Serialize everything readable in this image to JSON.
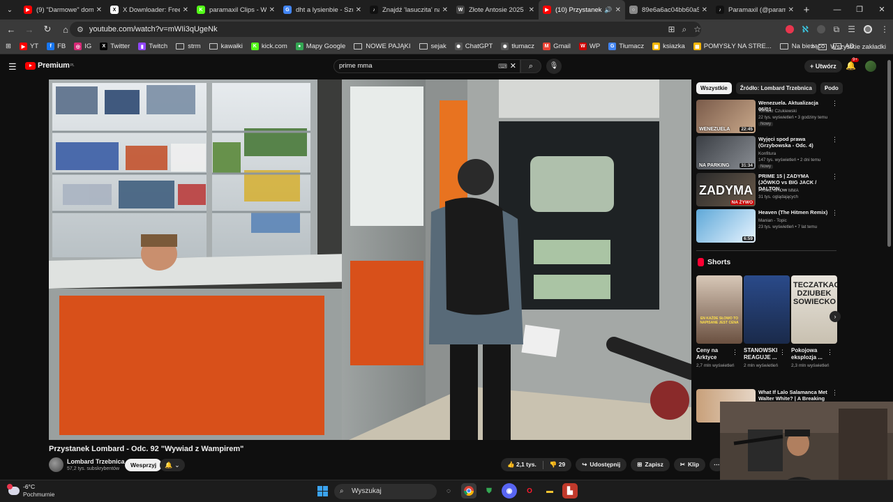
{
  "browser": {
    "tabs": [
      {
        "title": "(9) \"Darmowe\" domy",
        "favicon_color": "#ff0000",
        "favicon": "▶"
      },
      {
        "title": "X Downloader: Free T",
        "favicon_color": "#ffffff",
        "favicon": "X"
      },
      {
        "title": "paramaxil Clips - Wat",
        "favicon_color": "#53fc18",
        "favicon": "K"
      },
      {
        "title": "dht a lysienbie - Szuk",
        "favicon_color": "#4285f4",
        "favicon": "G"
      },
      {
        "title": "Znajdź 'lasuczita' na",
        "favicon_color": "#111111",
        "favicon": "♪"
      },
      {
        "title": "Złote Antosie 2025 -",
        "favicon_color": "#444444",
        "favicon": "W"
      },
      {
        "title": "(10) Przystanek Lo",
        "favicon_color": "#ff0000",
        "favicon": "▶",
        "active": true
      },
      {
        "title": "89e6a6ac04bb60a51",
        "favicon_color": "#888888",
        "favicon": "○"
      },
      {
        "title": "Paramaxil (@param",
        "favicon_color": "#111111",
        "favicon": "♪"
      }
    ],
    "url": "youtube.com/watch?v=mWIi3qUgeNk",
    "bookmarks": [
      {
        "label": "YT",
        "type": "icon",
        "color": "#ff0000",
        "glyph": "▶"
      },
      {
        "label": "FB",
        "type": "icon",
        "color": "#1877f2",
        "glyph": "f"
      },
      {
        "label": "IG",
        "type": "icon",
        "color": "#d62976",
        "glyph": "◎"
      },
      {
        "label": "Twitter",
        "type": "icon",
        "color": "#000000",
        "glyph": "X"
      },
      {
        "label": "Twitch",
        "type": "icon",
        "color": "#9146ff",
        "glyph": "▮"
      },
      {
        "label": "strm",
        "type": "folder"
      },
      {
        "label": "kawałki",
        "type": "folder"
      },
      {
        "label": "kick.com",
        "type": "icon",
        "color": "#53fc18",
        "glyph": "K"
      },
      {
        "label": "Mapy Google",
        "type": "icon",
        "color": "#34a853",
        "glyph": "●"
      },
      {
        "label": "NOWE PAJĄKI",
        "type": "folder"
      },
      {
        "label": "sejak",
        "type": "folder"
      },
      {
        "label": "ChatGPT",
        "type": "icon",
        "color": "#555555",
        "glyph": "✺"
      },
      {
        "label": "tłumacz",
        "type": "icon",
        "color": "#555555",
        "glyph": "✺"
      },
      {
        "label": "Gmail",
        "type": "icon",
        "color": "#ea4335",
        "glyph": "M"
      },
      {
        "label": "WP",
        "type": "icon",
        "color": "#cc0000",
        "glyph": "W"
      },
      {
        "label": "Tłumacz",
        "type": "icon",
        "color": "#4285f4",
        "glyph": "G"
      },
      {
        "label": "ksiazka",
        "type": "icon",
        "color": "#f4b400",
        "glyph": "▦"
      },
      {
        "label": "POMYSŁY NA STRE...",
        "type": "icon",
        "color": "#f4b400",
        "glyph": "▦"
      },
      {
        "label": "Na bieżąco",
        "type": "folder"
      },
      {
        "label": "AD",
        "type": "folder"
      }
    ],
    "all_bookmarks": "Wszystkie zakładki"
  },
  "youtube": {
    "logo": "Premium",
    "logo_region": "PL",
    "search_value": "prime mma",
    "create_label": "Utwórz",
    "notifications": "9+",
    "video_title": "Przystanek Lombard - Odc. 92 \"Wywiad z Wampirem\"",
    "channel": "Lombard Trzebnica",
    "subscribers": "57,2 tys. subskrybentów",
    "support_label": "Wesprzyj",
    "likes": "2,1 tys.",
    "dislikes": "29",
    "share": "Udostępnij",
    "save": "Zapisz",
    "clip": "Klip",
    "chips": [
      "Wszystkie",
      "Źródło: Lombard Trzebnica",
      "Podo"
    ],
    "recommendations": [
      {
        "title": "Wenezuela. Aktualizacja 06/01",
        "channel": "Tomasz Czukiewski",
        "meta": "22 tys. wyświetleń • 3 godziny temu",
        "badge": "Nowy",
        "duration": "22:45",
        "thumb_text": "WENEZUELA"
      },
      {
        "title": "Wyjęci spod prawa (Grzybowska - Odc. 4)",
        "channel": "Konfitura",
        "meta": "147 tys. wyświetleń • 2 dni temu",
        "badge": "Nowy",
        "duration": "31:34",
        "thumb_text": "NA PARKING"
      },
      {
        "title": "PRIME 15 | ZADYMA (JÓWKO vs BIG JACK / DALTON, ...",
        "channel": "PRIME SHOW MMA",
        "meta": "31 tys. oglądających",
        "badge": "",
        "duration": "NA ŻYWO",
        "thumb_text": "ZADYMA"
      },
      {
        "title": "Heaven (The Hitmen Remix)",
        "channel": "Manian - Topic",
        "meta": "23 tys. wyświetleń • 7 lat temu",
        "badge": "",
        "duration": "6:59",
        "thumb_text": ""
      }
    ],
    "shorts_label": "Shorts",
    "shorts": [
      {
        "title": "Ceny na Arktyce",
        "views": "2,7 mln wyświetleń",
        "thumb_text": "EN KAŻDE SŁOWO TO NAPISANE JEST CENA"
      },
      {
        "title": "STANOWSKI REAGUJE ...",
        "views": "2 mln wyświetleń",
        "thumb_text": ""
      },
      {
        "title": "Pokojowa eksplozja ...",
        "views": "2,3 mln wyświetleń",
        "thumb_text": "TECZATKAC DZIUBEK SOWIECKO"
      }
    ],
    "rec_bottom": {
      "title": "What If Lalo Salamanca Met Walter White? | A Breaking Ba..."
    }
  },
  "taskbar": {
    "temperature": "-6°C",
    "condition": "Pochmurnie",
    "search_placeholder": "Wyszukaj"
  }
}
